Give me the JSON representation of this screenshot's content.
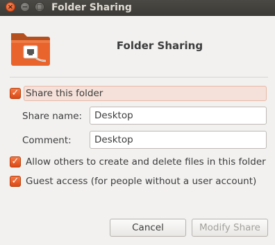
{
  "window": {
    "title": "Folder Sharing",
    "controls": {
      "close": "×",
      "minimize": "−",
      "maximize": "□"
    }
  },
  "header": {
    "heading": "Folder Sharing",
    "icon": "folder-share-icon"
  },
  "share_folder": {
    "label": "Share this folder",
    "checked": true
  },
  "share_name": {
    "label": "Share name:",
    "value": "Desktop"
  },
  "comment": {
    "label": "Comment:",
    "value": "Desktop"
  },
  "allow_others": {
    "label": "Allow others to create and delete files in this folder",
    "checked": true
  },
  "guest_access": {
    "label": "Guest access (for people without a user account)",
    "checked": true
  },
  "buttons": {
    "cancel": "Cancel",
    "modify": "Modify Share"
  },
  "colors": {
    "accent": "#dd4814",
    "highlight": "#f5e1d9",
    "titlebar": "#3c3b37"
  }
}
